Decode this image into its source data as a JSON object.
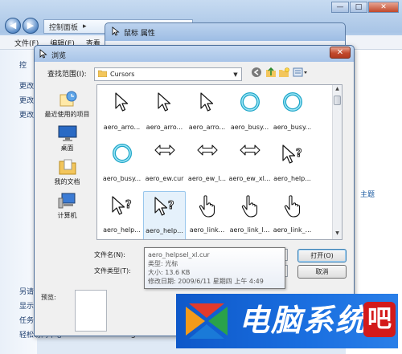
{
  "background_window": {
    "address": [
      "控制面板",
      "▸"
    ],
    "menu": [
      "文件(F)",
      "编辑(E)",
      "查看"
    ],
    "side_items": [
      "控",
      "更改",
      "更改",
      "更改",
      "另请",
      "显示",
      "任务",
      "轻松访问中心"
    ],
    "link_fragment": "主题",
    "status": "img0"
  },
  "mouse_properties": {
    "title": "鼠标 属性"
  },
  "dialog": {
    "title": "浏览",
    "close_label": "✕",
    "look_in_label": "查找范围(I):",
    "look_in_value": "Cursors",
    "places": [
      "最近使用的项目",
      "桌面",
      "我的文档",
      "计算机"
    ],
    "files": [
      {
        "name": "aero_arro...",
        "icon": "arrow"
      },
      {
        "name": "aero_arro...",
        "icon": "arrow"
      },
      {
        "name": "aero_arro...",
        "icon": "arrow"
      },
      {
        "name": "aero_busy...",
        "icon": "busy"
      },
      {
        "name": "aero_busy...",
        "icon": "busy"
      },
      {
        "name": "aero_busy...",
        "icon": "busy"
      },
      {
        "name": "aero_ew.cur",
        "icon": "ew"
      },
      {
        "name": "aero_ew_l...",
        "icon": "ew"
      },
      {
        "name": "aero_ew_xl...",
        "icon": "ew"
      },
      {
        "name": "aero_help...",
        "icon": "help"
      },
      {
        "name": "aero_help...",
        "icon": "help"
      },
      {
        "name": "aero_help...",
        "icon": "help",
        "selected": true
      },
      {
        "name": "aero_link...",
        "icon": "link"
      },
      {
        "name": "aero_link_l...",
        "icon": "link"
      },
      {
        "name": "aero_link_...",
        "icon": "link"
      }
    ],
    "filename_label": "文件名(N):",
    "filetype_label": "文件类型(T):",
    "open_button": "打开(O)",
    "cancel_button": "取消",
    "preview_label": "预览:",
    "tooltip": {
      "name": "aero_helpsel_xl.cur",
      "type": "类型: 光标",
      "size": "大小: 13.6 KB",
      "modified": "修改日期: 2009/6/11 星期四 上午 4:49"
    }
  },
  "watermark": {
    "text": "电脑系统",
    "seal": "吧"
  }
}
